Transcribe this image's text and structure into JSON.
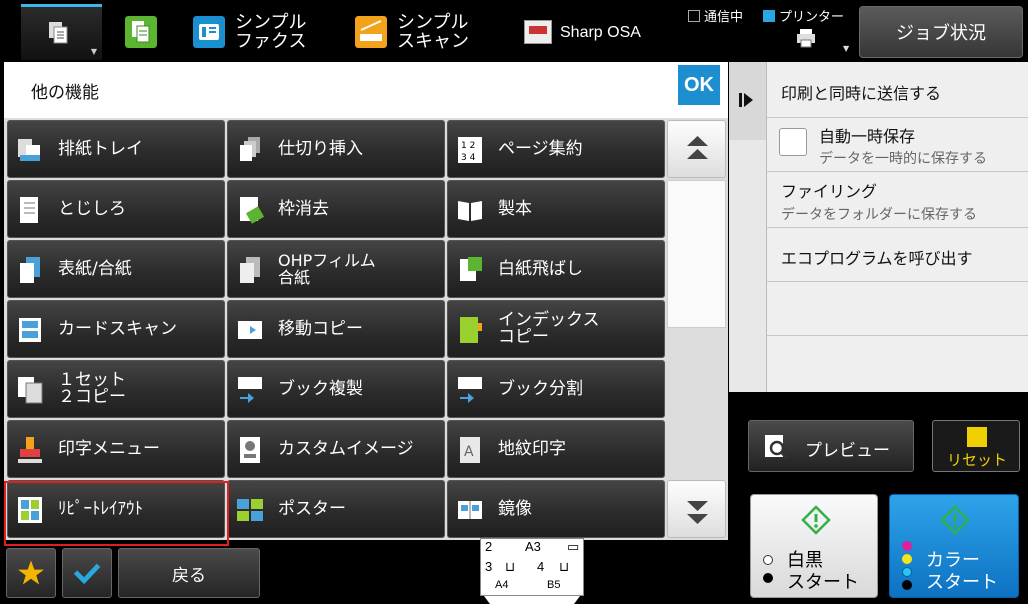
{
  "topbar": {
    "shortcuts": [
      {
        "label": "シンプル\nファクス",
        "icon": "fax-icon"
      },
      {
        "label": "シンプル\nスキャン",
        "icon": "scan-icon"
      }
    ],
    "osa_label": "Sharp OSA",
    "status_comm": "通信中",
    "status_printer": "プリンター",
    "job_status": "ジョブ状況"
  },
  "panel": {
    "title": "他の機能",
    "ok": "OK",
    "functions": [
      [
        "排紙トレイ",
        "仕切り挿入",
        "ページ集約"
      ],
      [
        "とじしろ",
        "枠消去",
        "製本"
      ],
      [
        "表紙/合紙",
        "OHPフィルム\n合紙",
        "白紙飛ばし"
      ],
      [
        "カードスキャン",
        "移動コピー",
        "インデックス\nコピー"
      ],
      [
        "１セット\n２コピー",
        "ブック複製",
        "ブック分割"
      ],
      [
        "印字メニュー",
        "カスタムイメージ",
        "地紋印字"
      ],
      [
        "ﾘﾋﾟｰﾄﾚｲｱｳﾄ",
        "ポスター",
        "鏡像"
      ]
    ]
  },
  "right_menu": {
    "send_while_print": "印刷と同時に送信する",
    "auto_save": "自動一時保存",
    "auto_save_sub": "データを一時的に保存する",
    "filing": "ファイリング",
    "filing_sub": "データをフォルダーに保存する",
    "eco_program": "エコプログラムを呼び出す"
  },
  "bottom": {
    "preview": "プレビュー",
    "reset": "リセット",
    "bw_line1": "白黒",
    "bw_line2": "スタート",
    "color_line1": "カラー",
    "color_line2": "スタート",
    "back": "戻る",
    "tray": {
      "t2": "2",
      "a3": "A3",
      "t3": "3",
      "a4": "A4",
      "t4": "4",
      "b5": "B5"
    }
  },
  "colors": {
    "accent": "#1d8ed0",
    "highlight": "#e02020",
    "reset": "#f0d000",
    "start_green": "#2db24a"
  }
}
